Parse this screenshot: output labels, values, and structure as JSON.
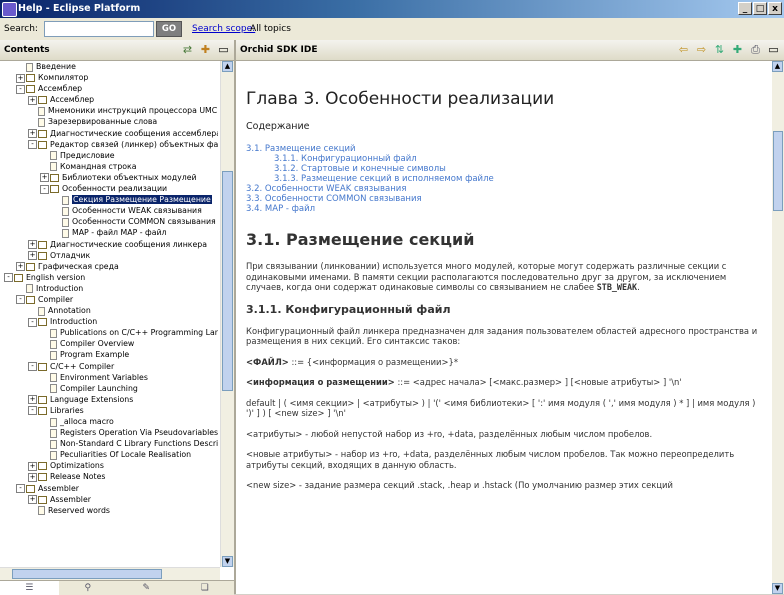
{
  "window": {
    "title": "Help - Eclipse Platform",
    "btn_min": "_",
    "btn_max": "□",
    "btn_close": "x"
  },
  "search": {
    "label": "Search:",
    "value": "",
    "go": "GO",
    "scope_label": "Search scope:",
    "scope_value": "All topics"
  },
  "contents": {
    "title": "Contents",
    "tree": [
      {
        "depth": 1,
        "exp": "",
        "icon": "page",
        "label": "Введение"
      },
      {
        "depth": 1,
        "exp": "+",
        "icon": "book",
        "label": "Компилятор"
      },
      {
        "depth": 1,
        "exp": "-",
        "icon": "book",
        "label": "Ассемблер"
      },
      {
        "depth": 2,
        "exp": "+",
        "icon": "book",
        "label": "Ассемблер"
      },
      {
        "depth": 2,
        "exp": "",
        "icon": "page",
        "label": "Мнемоники инструкций процессора UMC"
      },
      {
        "depth": 2,
        "exp": "",
        "icon": "page",
        "label": "Зарезервированные слова"
      },
      {
        "depth": 2,
        "exp": "+",
        "icon": "book",
        "label": "Диагностические сообщения ассемблера"
      },
      {
        "depth": 2,
        "exp": "-",
        "icon": "book",
        "label": "Редактор связей (линкер) объектных файлов"
      },
      {
        "depth": 3,
        "exp": "",
        "icon": "page",
        "label": "Предисловие"
      },
      {
        "depth": 3,
        "exp": "",
        "icon": "page",
        "label": "Командная строка"
      },
      {
        "depth": 3,
        "exp": "+",
        "icon": "book",
        "label": "Библиотеки объектных модулей"
      },
      {
        "depth": 3,
        "exp": "-",
        "icon": "book",
        "label": "Особенности реализации"
      },
      {
        "depth": 4,
        "exp": "",
        "icon": "page",
        "label": "Секция Размещение Размещение",
        "selected": true
      },
      {
        "depth": 4,
        "exp": "",
        "icon": "page",
        "label": "Особенности WEAK связывания"
      },
      {
        "depth": 4,
        "exp": "",
        "icon": "page",
        "label": "Особенности COMMON связывания"
      },
      {
        "depth": 4,
        "exp": "",
        "icon": "page",
        "label": "MAP - файл MAP - файл"
      },
      {
        "depth": 2,
        "exp": "+",
        "icon": "book",
        "label": "Диагностические сообщения линкера"
      },
      {
        "depth": 2,
        "exp": "+",
        "icon": "book",
        "label": "Отладчик"
      },
      {
        "depth": 1,
        "exp": "+",
        "icon": "book",
        "label": "Графическая среда"
      },
      {
        "depth": 0,
        "exp": "-",
        "icon": "book",
        "label": "English version"
      },
      {
        "depth": 1,
        "exp": "",
        "icon": "page",
        "label": "Introduction"
      },
      {
        "depth": 1,
        "exp": "-",
        "icon": "book",
        "label": "Compiler"
      },
      {
        "depth": 2,
        "exp": "",
        "icon": "page",
        "label": "Annotation"
      },
      {
        "depth": 2,
        "exp": "-",
        "icon": "book",
        "label": "Introduction"
      },
      {
        "depth": 3,
        "exp": "",
        "icon": "page",
        "label": "Publications on C/C++ Programming Language"
      },
      {
        "depth": 3,
        "exp": "",
        "icon": "page",
        "label": "Compiler Overview"
      },
      {
        "depth": 3,
        "exp": "",
        "icon": "page",
        "label": "Program Example"
      },
      {
        "depth": 2,
        "exp": "-",
        "icon": "book",
        "label": "C/C++ Compiler"
      },
      {
        "depth": 3,
        "exp": "",
        "icon": "page",
        "label": "Environment Variables"
      },
      {
        "depth": 3,
        "exp": "",
        "icon": "page",
        "label": "Compiler Launching"
      },
      {
        "depth": 2,
        "exp": "+",
        "icon": "book",
        "label": "Language Extensions"
      },
      {
        "depth": 2,
        "exp": "-",
        "icon": "book",
        "label": "Libraries"
      },
      {
        "depth": 3,
        "exp": "",
        "icon": "page",
        "label": "_alloca macro"
      },
      {
        "depth": 3,
        "exp": "",
        "icon": "page",
        "label": "Registers Operation Via Pseudovariables"
      },
      {
        "depth": 3,
        "exp": "",
        "icon": "page",
        "label": "Non-Standard C Library Functions Description"
      },
      {
        "depth": 3,
        "exp": "",
        "icon": "page",
        "label": "Peculiarities Of Locale Realisation"
      },
      {
        "depth": 2,
        "exp": "+",
        "icon": "book",
        "label": "Optimizations"
      },
      {
        "depth": 2,
        "exp": "+",
        "icon": "book",
        "label": "Release Notes"
      },
      {
        "depth": 1,
        "exp": "-",
        "icon": "book",
        "label": "Assembler"
      },
      {
        "depth": 2,
        "exp": "+",
        "icon": "book",
        "label": "Assembler"
      },
      {
        "depth": 2,
        "exp": "",
        "icon": "page",
        "label": "Reserved words"
      }
    ]
  },
  "doc": {
    "pane_title": "Orchid SDK IDE",
    "h1": "Глава 3. Особенности реализации",
    "toc_title": "Содержание",
    "toc": [
      {
        "lvl": 1,
        "text": "3.1. Размещение секций"
      },
      {
        "lvl": 2,
        "text": "3.1.1. Конфигурационный файл"
      },
      {
        "lvl": 2,
        "text": "3.1.2. Стартовые и конечные символы"
      },
      {
        "lvl": 2,
        "text": "3.1.3. Размещение секций в исполняемом файле"
      },
      {
        "lvl": 1,
        "text": "3.2. Особенности WEAK связывания"
      },
      {
        "lvl": 1,
        "text": "3.3. Особенности COMMON связывания"
      },
      {
        "lvl": 1,
        "text": "3.4. MAP - файл"
      }
    ],
    "h2": "3.1. Размещение секций",
    "p1": "При связывании (линковании) используется много модулей, которые могут содержать различные секции с одинаковыми именами. В памяти секции располагаются последовательно друг за другом, за исключением случаев, когда они содержат одинаковые символы со связыванием не слабее",
    "p1_code": "STB_WEAK",
    "p1_end": ".",
    "h3": "3.1.1. Конфигурационный файл",
    "p2": "Конфигурационный файл линкера предназначен для задания пользователем областей адресного пространства и размещения в них секций. Его синтаксис таков:",
    "g1a": "<ФАЙЛ>",
    "g1b": " ::= {<информация о размещении>}*",
    "g2a": "<информация о размещении>",
    "g2b": " ::= <адрес начала> [<макс.размер> ] [<новые атрибуты> ] '\\n'",
    "g3": "default | ( <имя секции> | <атрибуты> ) | '(' <имя библиотеки> [ ':' имя модуля ( ',' имя модуля ) * ] | имя модуля ) ')' ] ) [ <new size> ] '\\n'",
    "p3": "<атрибуты> - любой непустой набор из +ro, +data, разделённых любым числом пробелов.",
    "p4": "<новые атрибуты> - набор из +ro, +data, разделённых любым числом пробелов. Так можно переопределить атрибуты секций, входящих в данную область.",
    "p5": "<new size> - задание размера секций .stack, .heap и .hstack (По умолчанию размер этих секций"
  }
}
